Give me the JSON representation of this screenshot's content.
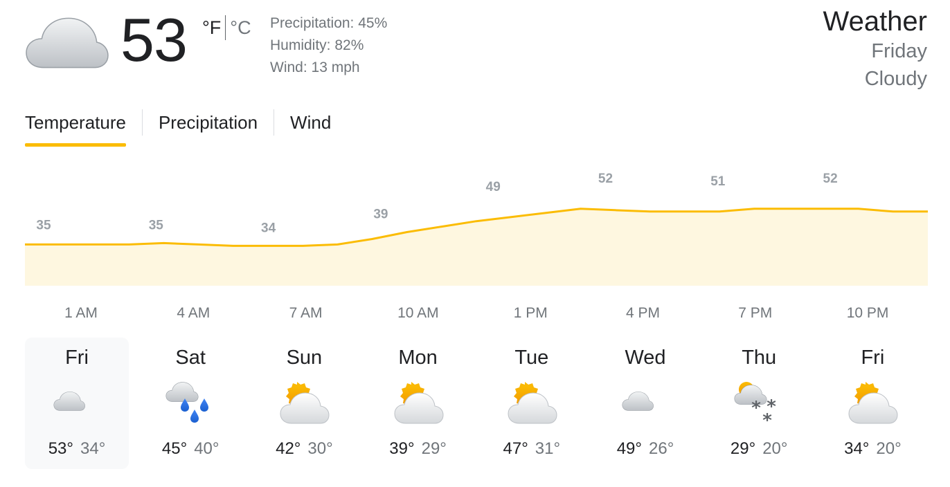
{
  "current": {
    "icon": "cloudy-icon",
    "temperature": "53",
    "unit_f": "°F",
    "unit_c": "°C",
    "precipitation": "Precipitation: 45%",
    "humidity": "Humidity: 82%",
    "wind": "Wind: 13 mph"
  },
  "header": {
    "title": "Weather",
    "day": "Friday",
    "condition": "Cloudy"
  },
  "tabs": [
    "Temperature",
    "Precipitation",
    "Wind"
  ],
  "active_tab": "Temperature",
  "colors": {
    "accent": "#fbbc04",
    "chart_fill": "#fef7e0",
    "label_gray": "#9aa0a6",
    "rain_blue": "#1a73e8"
  },
  "chart_data": {
    "type": "area",
    "x": [
      "1 AM",
      "4 AM",
      "7 AM",
      "10 AM",
      "1 PM",
      "4 PM",
      "7 PM",
      "10 PM"
    ],
    "values": [
      35,
      35,
      34,
      39,
      49,
      52,
      51,
      52
    ],
    "data_labels": [
      "35",
      "35",
      "34",
      "39",
      "49",
      "52",
      "51",
      "52"
    ],
    "line_values": [
      35,
      35,
      35,
      35,
      35.5,
      35,
      34.5,
      34.5,
      34.5,
      35,
      37,
      39.5,
      41.5,
      43.5,
      45,
      46.5,
      48,
      47.5,
      47,
      47,
      47,
      48,
      48,
      48,
      48,
      47,
      47
    ],
    "ylim": [
      20,
      56
    ],
    "grid": false,
    "legend": "none"
  },
  "days": [
    {
      "name": "Fri",
      "icon": "cloudy-icon",
      "high": "53°",
      "low": "34°",
      "selected": true
    },
    {
      "name": "Sat",
      "icon": "rain-icon",
      "high": "45°",
      "low": "40°",
      "selected": false
    },
    {
      "name": "Sun",
      "icon": "partly-cloudy-icon",
      "high": "42°",
      "low": "30°",
      "selected": false
    },
    {
      "name": "Mon",
      "icon": "partly-cloudy-icon",
      "high": "39°",
      "low": "29°",
      "selected": false
    },
    {
      "name": "Tue",
      "icon": "partly-cloudy-icon",
      "high": "47°",
      "low": "31°",
      "selected": false
    },
    {
      "name": "Wed",
      "icon": "cloudy-icon",
      "high": "49°",
      "low": "26°",
      "selected": false
    },
    {
      "name": "Thu",
      "icon": "snow-showers-icon",
      "high": "29°",
      "low": "20°",
      "selected": false
    },
    {
      "name": "Fri",
      "icon": "partly-cloudy-icon",
      "high": "34°",
      "low": "20°",
      "selected": false
    }
  ]
}
